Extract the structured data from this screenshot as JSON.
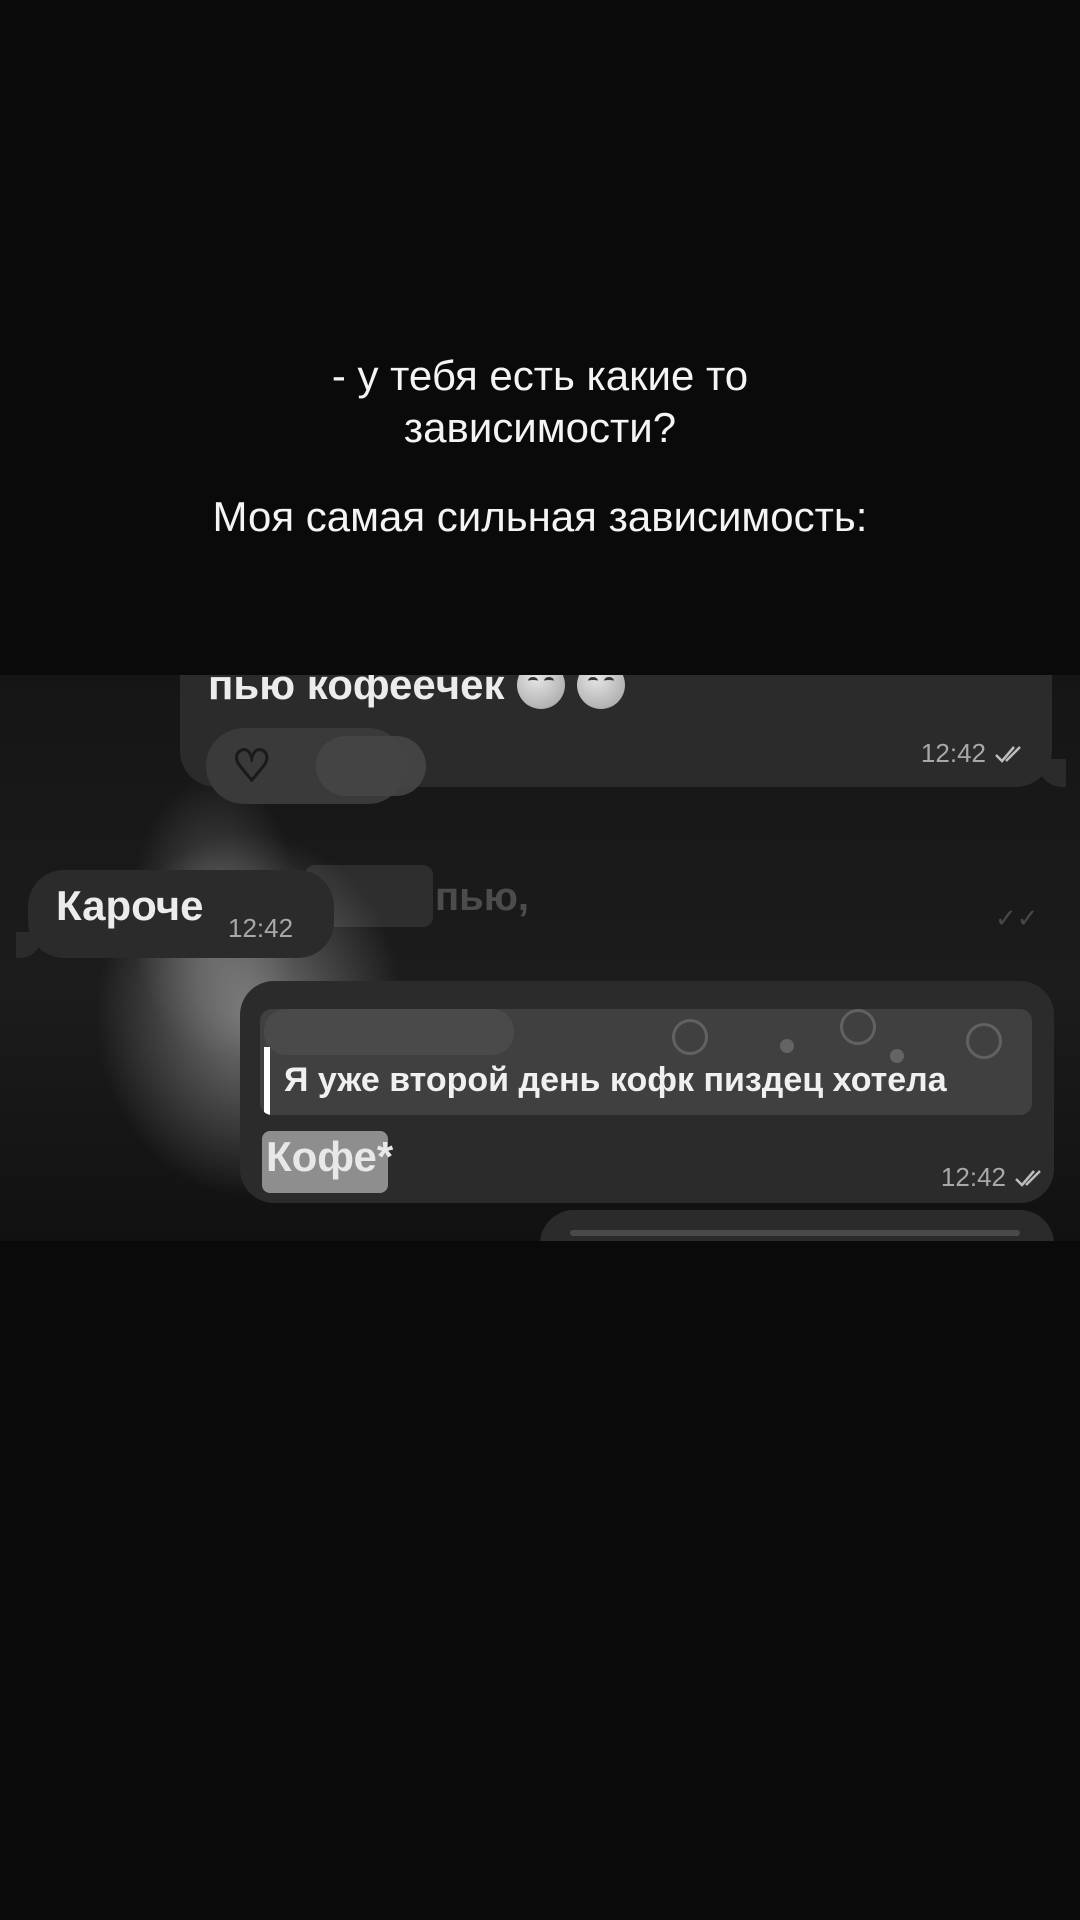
{
  "caption": {
    "question_line1": "- у тебя есть какие то",
    "question_line2": "зависимости?",
    "answer": "Моя самая сильная зависимость:"
  },
  "chat": {
    "background_color": "#171717",
    "bubble_color": "#2b2b2b",
    "messages": [
      {
        "text": "пью кофеёчек",
        "emojis": [
          "smiling-face-icon",
          "smiling-face-icon"
        ],
        "reaction": "heart-icon",
        "time": "12:42",
        "status": "read-checks-icon",
        "outgoing": true
      },
      {
        "text": "Кароче",
        "time": "12:42",
        "outgoing": false
      },
      {
        "reply_to_text": "Я уже второй день кофк пиздец хотела",
        "text": "Кофе*",
        "time": "12:42",
        "status": "read-checks-icon",
        "outgoing": true
      }
    ],
    "background_ghost": {
      "text": "пью,"
    }
  }
}
